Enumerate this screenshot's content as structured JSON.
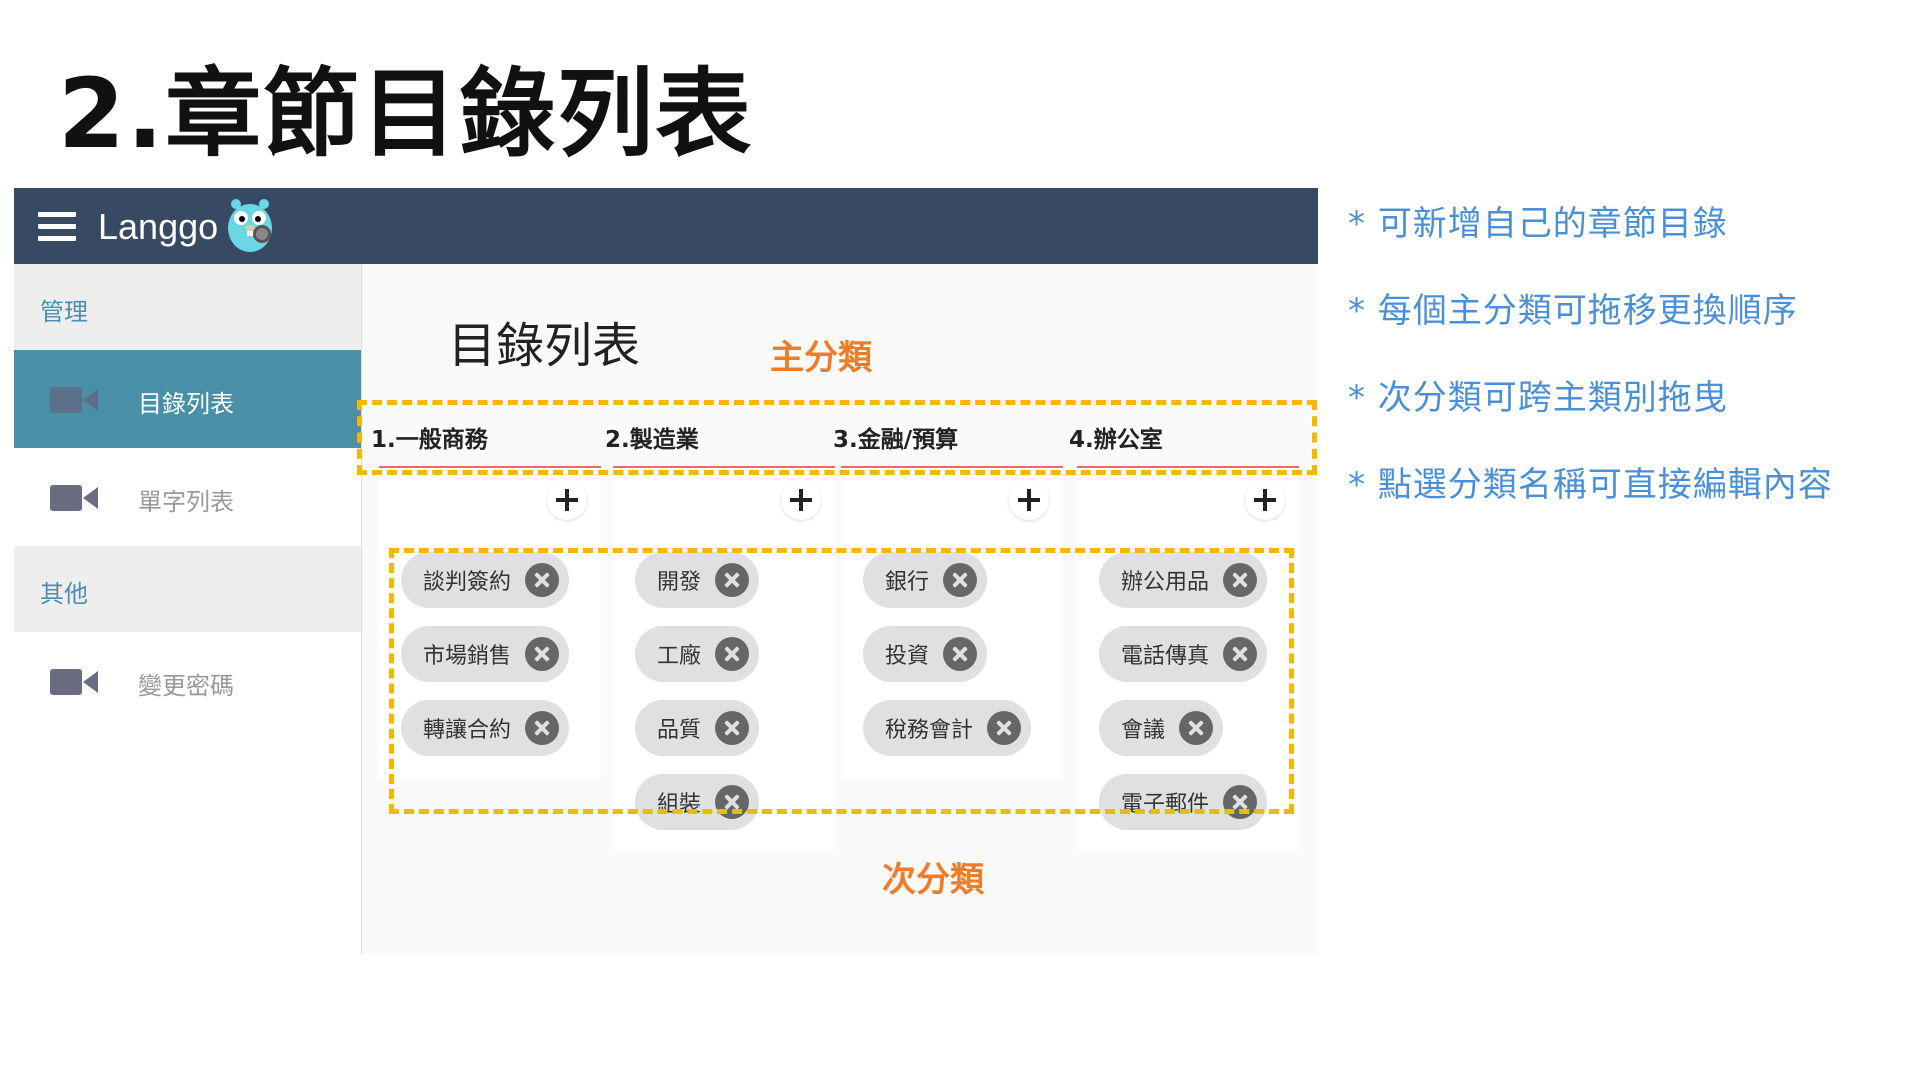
{
  "slide": {
    "title": "2.章節目錄列表"
  },
  "app": {
    "brand": "Langgo",
    "colors": {
      "appbar": "#384963",
      "active": "#4a8fa8",
      "accent_line": "#e8677a"
    }
  },
  "sidebar": {
    "section_manage": "管理",
    "section_other": "其他",
    "items": [
      {
        "label": "目錄列表",
        "icon": "video-camera-icon",
        "active": true
      },
      {
        "label": "單字列表",
        "icon": "video-camera-icon",
        "active": false
      },
      {
        "label": "變更密碼",
        "icon": "video-camera-icon",
        "active": false
      }
    ]
  },
  "main": {
    "title": "目錄列表",
    "columns": [
      {
        "name": "1.一般商務",
        "chips": [
          "談判簽約",
          "市場銷售",
          "轉讓合約"
        ]
      },
      {
        "name": "2.製造業",
        "chips": [
          "開發",
          "工廠",
          "品質",
          "組裝"
        ]
      },
      {
        "name": "3.金融/預算",
        "chips": [
          "銀行",
          "投資",
          "稅務會計"
        ]
      },
      {
        "name": "4.辦公室",
        "chips": [
          "辦公用品",
          "電話傳真",
          "會議",
          "電子郵件"
        ]
      }
    ]
  },
  "annotations": {
    "main_category": "主分類",
    "sub_category": "次分類",
    "highlight_color": "#f5b800"
  },
  "notes": [
    "* 可新增自己的章節目錄",
    "* 每個主分類可拖移更換順序",
    "* 次分類可跨主類別拖曳",
    "* 點選分類名稱可直接編輯內容"
  ]
}
